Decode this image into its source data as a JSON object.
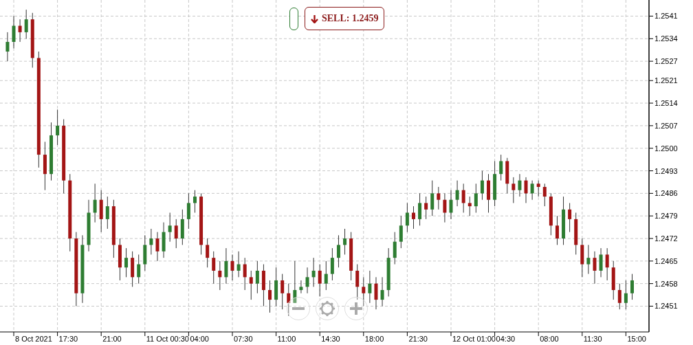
{
  "sell_button": {
    "label": "SELL: 1.2459"
  },
  "chart": {
    "chart_data": {
      "type": "candlestick",
      "categories": [
        null,
        null,
        null,
        null,
        null,
        null,
        null,
        null,
        null,
        null,
        null,
        null,
        null,
        null,
        null,
        null,
        null,
        null,
        null,
        null,
        null,
        null,
        null,
        null,
        null,
        null,
        null,
        null,
        null,
        null,
        null,
        null,
        null,
        null,
        null,
        null,
        null,
        null,
        null,
        null,
        null,
        null,
        null,
        null,
        null,
        null,
        null,
        null,
        null,
        null,
        null,
        null,
        null,
        null,
        null,
        null,
        null,
        null,
        null,
        null,
        null,
        null,
        null,
        null,
        null,
        null,
        null,
        null,
        null,
        null,
        null,
        null,
        null,
        null,
        null,
        null,
        null,
        null,
        null,
        null,
        null,
        null,
        null,
        null,
        null,
        null,
        null,
        null,
        null,
        null,
        null,
        null,
        null,
        null,
        null,
        null,
        null,
        null,
        null,
        null,
        null
      ],
      "ylim": [
        1.2443,
        1.2546
      ],
      "grid": true,
      "ohlc": [
        [
          1.253,
          1.2536,
          1.2527,
          1.2533
        ],
        [
          1.2533,
          1.2541,
          1.2531,
          1.2538
        ],
        [
          1.2538,
          1.254,
          1.2533,
          1.2536
        ],
        [
          1.2536,
          1.2543,
          1.2534,
          1.254
        ],
        [
          1.254,
          1.2542,
          1.2525,
          1.2528
        ],
        [
          1.2528,
          1.253,
          1.2494,
          1.2498
        ],
        [
          1.2498,
          1.2502,
          1.2487,
          1.2492
        ],
        [
          1.2492,
          1.2508,
          1.249,
          1.2504
        ],
        [
          1.2504,
          1.2512,
          1.2501,
          1.2507
        ],
        [
          1.2507,
          1.2509,
          1.2486,
          1.249
        ],
        [
          1.249,
          1.2492,
          1.2468,
          1.2472
        ],
        [
          1.2472,
          1.2474,
          1.2451,
          1.2455
        ],
        [
          1.2455,
          1.2473,
          1.2452,
          1.247
        ],
        [
          1.247,
          1.2484,
          1.2468,
          1.248
        ],
        [
          1.248,
          1.2489,
          1.2477,
          1.2484
        ],
        [
          1.2484,
          1.2487,
          1.2474,
          1.2478
        ],
        [
          1.2478,
          1.2485,
          1.2475,
          1.2482
        ],
        [
          1.2482,
          1.2484,
          1.2466,
          1.247
        ],
        [
          1.247,
          1.2472,
          1.2459,
          1.2463
        ],
        [
          1.2463,
          1.2469,
          1.246,
          1.2466
        ],
        [
          1.2466,
          1.2468,
          1.2457,
          1.246
        ],
        [
          1.246,
          1.2467,
          1.2458,
          1.2464
        ],
        [
          1.2464,
          1.2473,
          1.2462,
          1.247
        ],
        [
          1.247,
          1.2475,
          1.2467,
          1.2472
        ],
        [
          1.2472,
          1.2474,
          1.2465,
          1.2468
        ],
        [
          1.2468,
          1.2477,
          1.2466,
          1.2474
        ],
        [
          1.2474,
          1.248,
          1.2471,
          1.2476
        ],
        [
          1.2476,
          1.2478,
          1.2469,
          1.2472
        ],
        [
          1.2472,
          1.2481,
          1.247,
          1.2478
        ],
        [
          1.2478,
          1.2486,
          1.2475,
          1.2483
        ],
        [
          1.2483,
          1.2487,
          1.248,
          1.2485
        ],
        [
          1.2485,
          1.2486,
          1.2467,
          1.247
        ],
        [
          1.247,
          1.2472,
          1.2463,
          1.2466
        ],
        [
          1.2466,
          1.2468,
          1.2458,
          1.2462
        ],
        [
          1.2462,
          1.2465,
          1.2456,
          1.246
        ],
        [
          1.246,
          1.2469,
          1.2458,
          1.2465
        ],
        [
          1.2465,
          1.2467,
          1.2459,
          1.2462
        ],
        [
          1.2462,
          1.2468,
          1.246,
          1.2464
        ],
        [
          1.2464,
          1.2466,
          1.2456,
          1.246
        ],
        [
          1.246,
          1.2462,
          1.2453,
          1.2458
        ],
        [
          1.2458,
          1.2465,
          1.2455,
          1.2462
        ],
        [
          1.2462,
          1.2464,
          1.2451,
          1.2456
        ],
        [
          1.2456,
          1.2459,
          1.2449,
          1.2453
        ],
        [
          1.2453,
          1.2463,
          1.2451,
          1.2459
        ],
        [
          1.2459,
          1.2461,
          1.245,
          1.2455
        ],
        [
          1.2455,
          1.2458,
          1.2448,
          1.2452
        ],
        [
          1.2452,
          1.2465,
          1.2452,
          1.2456
        ],
        [
          1.2456,
          1.2459,
          1.2455,
          1.2457
        ],
        [
          1.2457,
          1.2463,
          1.2455,
          1.246
        ],
        [
          1.246,
          1.2466,
          1.2457,
          1.2462
        ],
        [
          1.2462,
          1.2464,
          1.2454,
          1.2458
        ],
        [
          1.2458,
          1.2465,
          1.2456,
          1.2461
        ],
        [
          1.2461,
          1.2469,
          1.2459,
          1.2466
        ],
        [
          1.2466,
          1.2473,
          1.2463,
          1.247
        ],
        [
          1.247,
          1.2475,
          1.2467,
          1.2472
        ],
        [
          1.2472,
          1.2474,
          1.2459,
          1.2462
        ],
        [
          1.2462,
          1.2464,
          1.2453,
          1.2457
        ],
        [
          1.2457,
          1.246,
          1.2451,
          1.2455
        ],
        [
          1.2455,
          1.2462,
          1.2452,
          1.2458
        ],
        [
          1.2458,
          1.246,
          1.245,
          1.2453
        ],
        [
          1.2453,
          1.246,
          1.2451,
          1.2456
        ],
        [
          1.2456,
          1.2469,
          1.2454,
          1.2466
        ],
        [
          1.2466,
          1.2474,
          1.2464,
          1.2471
        ],
        [
          1.2471,
          1.2479,
          1.2469,
          1.2476
        ],
        [
          1.2476,
          1.2483,
          1.2474,
          1.248
        ],
        [
          1.248,
          1.2482,
          1.2475,
          1.2478
        ],
        [
          1.2478,
          1.2486,
          1.2476,
          1.2483
        ],
        [
          1.2483,
          1.2485,
          1.2478,
          1.2481
        ],
        [
          1.2481,
          1.249,
          1.2479,
          1.2486
        ],
        [
          1.2486,
          1.2488,
          1.2481,
          1.2484
        ],
        [
          1.2484,
          1.2486,
          1.2477,
          1.248
        ],
        [
          1.248,
          1.2487,
          1.2478,
          1.2484
        ],
        [
          1.2484,
          1.249,
          1.2482,
          1.2487
        ],
        [
          1.2487,
          1.2489,
          1.248,
          1.2483
        ],
        [
          1.2483,
          1.2485,
          1.2479,
          1.2482
        ],
        [
          1.2482,
          1.2489,
          1.248,
          1.2486
        ],
        [
          1.2486,
          1.2493,
          1.2484,
          1.249
        ],
        [
          1.249,
          1.2492,
          1.248,
          1.2484
        ],
        [
          1.2484,
          1.2496,
          1.2482,
          1.2492
        ],
        [
          1.2492,
          1.2498,
          1.249,
          1.2496
        ],
        [
          1.2496,
          1.2497,
          1.2486,
          1.2489
        ],
        [
          1.2489,
          1.2491,
          1.2483,
          1.2487
        ],
        [
          1.2487,
          1.2492,
          1.2485,
          1.249
        ],
        [
          1.249,
          1.2491,
          1.2483,
          1.2486
        ],
        [
          1.2486,
          1.249,
          1.2484,
          1.2489
        ],
        [
          1.2489,
          1.249,
          1.2485,
          1.2488
        ],
        [
          1.2488,
          1.2489,
          1.2482,
          1.2485
        ],
        [
          1.2485,
          1.2486,
          1.2473,
          1.2476
        ],
        [
          1.2476,
          1.2479,
          1.247,
          1.2472
        ],
        [
          1.2472,
          1.2485,
          1.247,
          1.2481
        ],
        [
          1.2481,
          1.2483,
          1.2474,
          1.2478
        ],
        [
          1.2478,
          1.248,
          1.2467,
          1.247
        ],
        [
          1.247,
          1.2472,
          1.246,
          1.2464
        ],
        [
          1.2464,
          1.247,
          1.2461,
          1.2466
        ],
        [
          1.2466,
          1.2468,
          1.2458,
          1.2462
        ],
        [
          1.2462,
          1.2469,
          1.246,
          1.2467
        ],
        [
          1.2467,
          1.2469,
          1.2459,
          1.2463
        ],
        [
          1.2463,
          1.2465,
          1.2453,
          1.2456
        ],
        [
          1.2456,
          1.2458,
          1.245,
          1.2452
        ],
        [
          1.2452,
          1.2459,
          1.245,
          1.2455
        ],
        [
          1.2455,
          1.2461,
          1.2453,
          1.2459
        ]
      ],
      "yticks": [
        {
          "value": 1.2541,
          "label": "1.2541"
        },
        {
          "value": 1.2534,
          "label": "1.2534"
        },
        {
          "value": 1.2527,
          "label": "1.2527"
        },
        {
          "value": 1.2521,
          "label": "1.2521"
        },
        {
          "value": 1.2514,
          "label": "1.2514"
        },
        {
          "value": 1.2507,
          "label": "1.2507"
        },
        {
          "value": 1.25,
          "label": "1.2500"
        },
        {
          "value": 1.2493,
          "label": "1.2493"
        },
        {
          "value": 1.2486,
          "label": "1.2486"
        },
        {
          "value": 1.2479,
          "label": "1.2479"
        },
        {
          "value": 1.2472,
          "label": "1.2472"
        },
        {
          "value": 1.2465,
          "label": "1.2465"
        },
        {
          "value": 1.2458,
          "label": "1.2458"
        },
        {
          "value": 1.2451,
          "label": "1.2451"
        }
      ]
    },
    "time_labels": [
      "8 Oct 2021",
      "17:30",
      "21:00",
      "11 Oct 00:30",
      "04:00",
      "07:30",
      "11:00",
      "14:30",
      "18:00",
      "21:30",
      "12 Oct 01:00",
      "04:30",
      "08:00",
      "11:30",
      "15:00"
    ]
  }
}
